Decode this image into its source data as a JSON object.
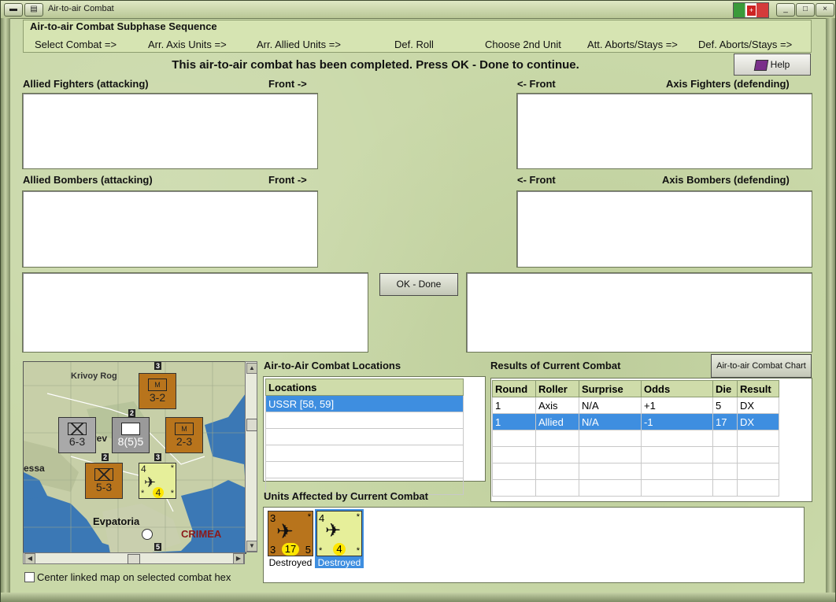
{
  "window": {
    "title": "Air-to-air Combat"
  },
  "sequence": {
    "title": "Air-to-air Combat Subphase Sequence",
    "steps": [
      "Select Combat =>",
      "Arr. Axis Units =>",
      "Arr. Allied Units =>",
      "Def. Roll",
      "Choose 2nd Unit",
      "Att. Aborts/Stays =>",
      "Def. Aborts/Stays =>"
    ]
  },
  "message": "This air-to-air combat has been completed.  Press OK - Done to continue.",
  "help_label": "Help",
  "panels": {
    "allied_fighters": "Allied Fighters (attacking)",
    "axis_fighters": "Axis Fighters (defending)",
    "allied_bombers": "Allied Bombers (attacking)",
    "axis_bombers": "Axis Bombers (defending)",
    "front_right": "Front ->",
    "front_left": "<- Front"
  },
  "ok_label": "OK - Done",
  "map": {
    "places": {
      "krivoy_rog": "Krivoy Rog",
      "evpatoria": "Evpatoria",
      "crimea": "CRIMEA",
      "essa": "essa",
      "yev": "yev"
    },
    "counters": {
      "c1": "3-2",
      "c2": "6-3",
      "c3": "8(5)5",
      "c4": "2-3",
      "c5": "5-3",
      "c1_tag": "M",
      "c4_tag": "M",
      "air_left": "4",
      "air_right": "*",
      "air_bl": "*",
      "air_br": "*",
      "air_val": "4"
    },
    "stacks": {
      "s1": "3",
      "s2": "2",
      "s3": "2",
      "s4": "3",
      "s5": "5"
    }
  },
  "center_checkbox": "Center linked map on selected combat hex",
  "locations": {
    "title": "Air-to-Air Combat Locations",
    "header": "Locations",
    "rows": [
      "USSR [58, 59]",
      "",
      "",
      "",
      "",
      ""
    ]
  },
  "results": {
    "title": "Results of Current Combat",
    "chart_button": "Air-to-air Combat Chart",
    "columns": [
      "Round",
      "Roller",
      "Surprise",
      "Odds",
      "Die",
      "Result"
    ],
    "rows": [
      [
        "1",
        "Axis",
        "N/A",
        "+1",
        "5",
        "DX"
      ],
      [
        "1",
        "Allied",
        "N/A",
        "-1",
        "17",
        "DX"
      ],
      [
        "",
        "",
        "",
        "",
        "",
        ""
      ],
      [
        "",
        "",
        "",
        "",
        "",
        ""
      ],
      [
        "",
        "",
        "",
        "",
        "",
        ""
      ],
      [
        "",
        "",
        "",
        "",
        "",
        ""
      ]
    ]
  },
  "affected": {
    "title": "Units Affected by Current Combat",
    "units": [
      {
        "tl": "3",
        "tr": "*",
        "bl": "3",
        "mid": "17",
        "br": "5",
        "status": "Destroyed"
      },
      {
        "tl": "4",
        "tr": "*",
        "bl": "*",
        "mid": "4",
        "br": "*",
        "status": "Destroyed"
      }
    ]
  }
}
